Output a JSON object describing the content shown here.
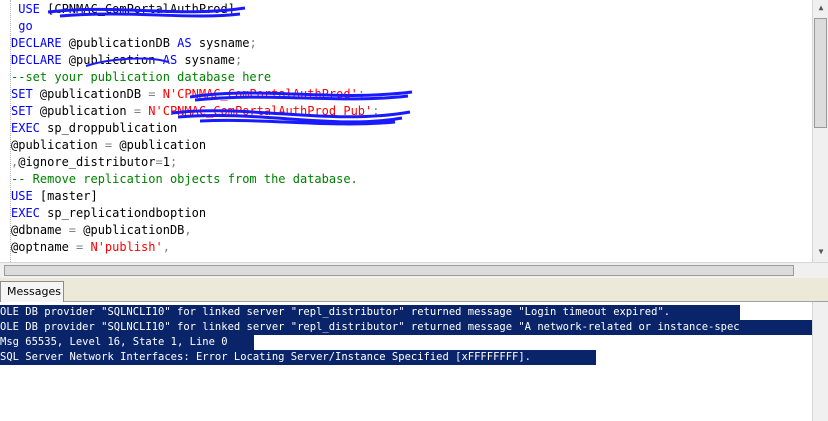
{
  "editor": {
    "lines": [
      [
        {
          "c": "kw",
          "t": " USE "
        },
        {
          "c": "txt",
          "t": "[CPNMAC_ComPortalAuthProd]"
        }
      ],
      [
        {
          "c": "kw",
          "t": " go"
        }
      ],
      [
        {
          "c": "kw",
          "t": "DECLARE "
        },
        {
          "c": "txt",
          "t": "@publicationDB "
        },
        {
          "c": "kw",
          "t": "AS "
        },
        {
          "c": "txt",
          "t": "sysname"
        },
        {
          "c": "grey",
          "t": ";"
        }
      ],
      [
        {
          "c": "kw",
          "t": "DECLARE "
        },
        {
          "c": "txt",
          "t": "@publication "
        },
        {
          "c": "kw",
          "t": "AS "
        },
        {
          "c": "txt",
          "t": "sysname"
        },
        {
          "c": "grey",
          "t": ";"
        }
      ],
      [
        {
          "c": "cm",
          "t": "--set your publication database here"
        }
      ],
      [
        {
          "c": "kw",
          "t": "SET "
        },
        {
          "c": "txt",
          "t": "@publicationDB "
        },
        {
          "c": "grey",
          "t": "= "
        },
        {
          "c": "str",
          "t": "N'CPNMAC_ComPortalAuthProd'"
        },
        {
          "c": "grey",
          "t": ";"
        }
      ],
      [
        {
          "c": "kw",
          "t": "SET "
        },
        {
          "c": "txt",
          "t": "@publication "
        },
        {
          "c": "grey",
          "t": "= "
        },
        {
          "c": "str",
          "t": "N'CPNMAC_ComPortalAuthProd_Pub'"
        },
        {
          "c": "grey",
          "t": ";"
        }
      ],
      [
        {
          "c": "kw",
          "t": "EXEC "
        },
        {
          "c": "txt",
          "t": "sp_droppublication"
        }
      ],
      [
        {
          "c": "txt",
          "t": "@publication "
        },
        {
          "c": "grey",
          "t": "= "
        },
        {
          "c": "txt",
          "t": "@publication"
        }
      ],
      [
        {
          "c": "grey",
          "t": ","
        },
        {
          "c": "txt",
          "t": "@ignore_distributor"
        },
        {
          "c": "grey",
          "t": "="
        },
        {
          "c": "txt",
          "t": "1"
        },
        {
          "c": "grey",
          "t": ";"
        }
      ],
      [
        {
          "c": "cm",
          "t": "-- Remove replication objects from the database."
        }
      ],
      [
        {
          "c": "kw",
          "t": "USE "
        },
        {
          "c": "txt",
          "t": "[master]"
        }
      ],
      [
        {
          "c": "kw",
          "t": "EXEC "
        },
        {
          "c": "txt",
          "t": "sp_replicationdboption"
        }
      ],
      [
        {
          "c": "txt",
          "t": "@dbname "
        },
        {
          "c": "grey",
          "t": "= "
        },
        {
          "c": "txt",
          "t": "@publicationDB"
        },
        {
          "c": "grey",
          "t": ","
        }
      ],
      [
        {
          "c": "txt",
          "t": "@optname "
        },
        {
          "c": "grey",
          "t": "= "
        },
        {
          "c": "str",
          "t": "N'publish'"
        },
        {
          "c": "grey",
          "t": ","
        }
      ]
    ]
  },
  "results": {
    "tab_label": "Messages",
    "messages": [
      "OLE DB provider \"SQLNCLI10\" for linked server \"repl_distributor\" returned message \"Login timeout expired\".",
      "OLE DB provider \"SQLNCLI10\" for linked server \"repl_distributor\" returned message \"A network-related or instance-spec",
      "Msg 65535, Level 16, State 1, Line 0",
      "SQL Server Network Interfaces: Error Locating Server/Instance Specified [xFFFFFFFF]."
    ]
  },
  "colors": {
    "keyword": "#0000ff",
    "string": "#ff0000",
    "comment": "#008000",
    "selection": "#0a246a",
    "redaction": "#1a1aff"
  }
}
